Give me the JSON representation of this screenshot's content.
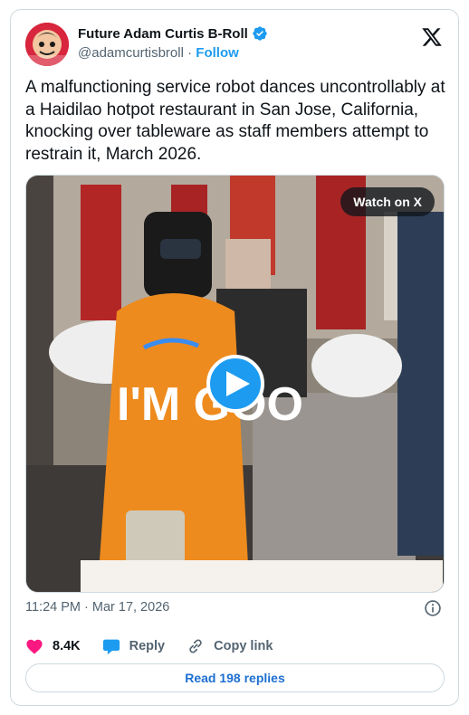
{
  "account": {
    "display_name": "Future Adam Curtis B-Roll",
    "handle": "@adamcurtisbroll",
    "separator": "·",
    "follow_label": "Follow",
    "avatar_icon": "red-cartoon-face-avatar",
    "verified_icon": "verified-badge-icon",
    "verified_color": "#1d9bf0"
  },
  "tweet": {
    "text": "A malfunctioning service robot dances uncontrollably at a Haidilao hotpot restaurant in San Jose, California, knocking over tableware as staff members attempt to restrain it, March 2026.",
    "timestamp": "11:24 PM · Mar 17, 2026"
  },
  "media": {
    "watch_label": "Watch on X",
    "play_icon": "play-icon",
    "robot_sign_text": "I'M GOO"
  },
  "actions": {
    "like_count": "8.4K",
    "reply_label": "Reply",
    "copy_link_label": "Copy link",
    "like_color": "#f91880",
    "reply_color": "#1d9bf0"
  },
  "footer": {
    "read_replies_label": "Read 198 replies"
  },
  "brand": {
    "x_logo_icon": "x-logo-icon"
  }
}
